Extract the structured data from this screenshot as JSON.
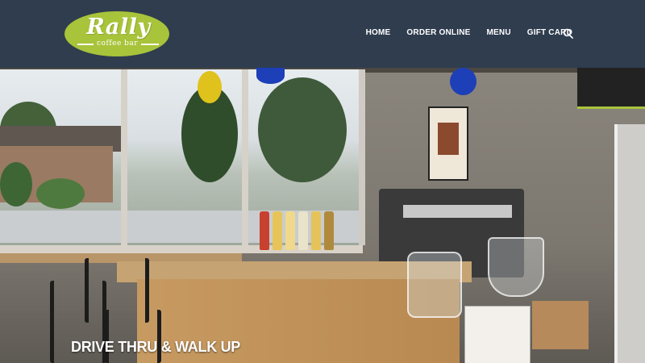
{
  "brand": {
    "name": "Rally",
    "tagline": "coffee bar",
    "logo_color": "#a8c43a"
  },
  "header": {
    "background": "#2f3d4f",
    "nav": [
      {
        "label": "HOME"
      },
      {
        "label": "ORDER ONLINE"
      },
      {
        "label": "MENU"
      },
      {
        "label": "GIFT CARD"
      }
    ],
    "search_icon": "search-icon"
  },
  "hero": {
    "caption": "DRIVE THRU & WALK UP"
  }
}
